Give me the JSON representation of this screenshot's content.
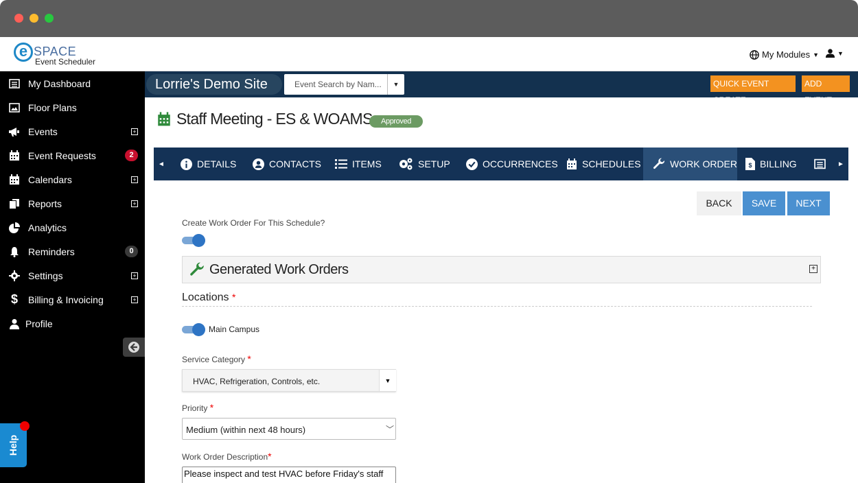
{
  "app": {
    "logo_text": "SPACE",
    "logo_subtitle": "Event Scheduler",
    "my_modules": "My Modules"
  },
  "sidebar": {
    "items": [
      {
        "label": "My Dashboard",
        "icon": "dashboard-icon"
      },
      {
        "label": "Floor Plans",
        "icon": "image-icon"
      },
      {
        "label": "Events",
        "icon": "megaphone-icon",
        "expandable": true
      },
      {
        "label": "Event Requests",
        "icon": "calendar-icon",
        "badge": "2"
      },
      {
        "label": "Calendars",
        "icon": "calendar-icon",
        "expandable": true
      },
      {
        "label": "Reports",
        "icon": "copy-icon",
        "expandable": true
      },
      {
        "label": "Analytics",
        "icon": "pie-chart-icon"
      },
      {
        "label": "Reminders",
        "icon": "bell-icon",
        "badge": "0"
      },
      {
        "label": "Settings",
        "icon": "gear-icon",
        "expandable": true
      },
      {
        "label": "Billing & Invoicing",
        "icon": "dollar-icon",
        "expandable": true
      },
      {
        "label": "Profile",
        "icon": "user-icon"
      }
    ],
    "help_label": "Help"
  },
  "topbar": {
    "site_name": "Lorrie's Demo Site",
    "event_search_placeholder": "Event Search by Nam...",
    "quick_event_create": "QUICK EVENT CREATE",
    "add_event": "ADD EVENT"
  },
  "event": {
    "title": "Staff Meeting - ES & WOAMS",
    "status": "Approved"
  },
  "tabs": [
    {
      "label": "DETAILS",
      "icon": "info-icon"
    },
    {
      "label": "CONTACTS",
      "icon": "user-circle-icon"
    },
    {
      "label": "ITEMS",
      "icon": "list-icon"
    },
    {
      "label": "SETUP",
      "icon": "gears-icon"
    },
    {
      "label": "OCCURRENCES",
      "icon": "check-circle-icon"
    },
    {
      "label": "SCHEDULES",
      "icon": "calendar-icon"
    },
    {
      "label": "WORK ORDER",
      "icon": "wrench-icon",
      "active": true
    },
    {
      "label": "BILLING",
      "icon": "invoice-icon"
    }
  ],
  "actions": {
    "back": "BACK",
    "save": "SAVE",
    "next": "NEXT"
  },
  "form": {
    "create_work_order_label": "Create Work Order For This Schedule?",
    "create_work_order_on": true,
    "generated_work_orders_title": "Generated Work Orders",
    "locations_label": "Locations",
    "location_name": "Main Campus",
    "location_on": true,
    "service_category_label": "Service Category",
    "service_category_value": "HVAC, Refrigeration, Controls, etc.",
    "priority_label": "Priority",
    "priority_value": "Medium (within next 48 hours)",
    "description_label": "Work Order Description",
    "description_value": "Please inspect and test HVAC before Friday's staff",
    "required_mark": "*"
  },
  "colors": {
    "sidebar_bg": "#000000",
    "topbar_bg": "#13314f",
    "tabs_bg": "#143256",
    "active_tab_bg": "#2a4f78",
    "accent_orange": "#f39220",
    "primary_blue": "#4a90d0",
    "approved_green": "#6c9b63",
    "calendar_green": "#2f8a3b"
  }
}
